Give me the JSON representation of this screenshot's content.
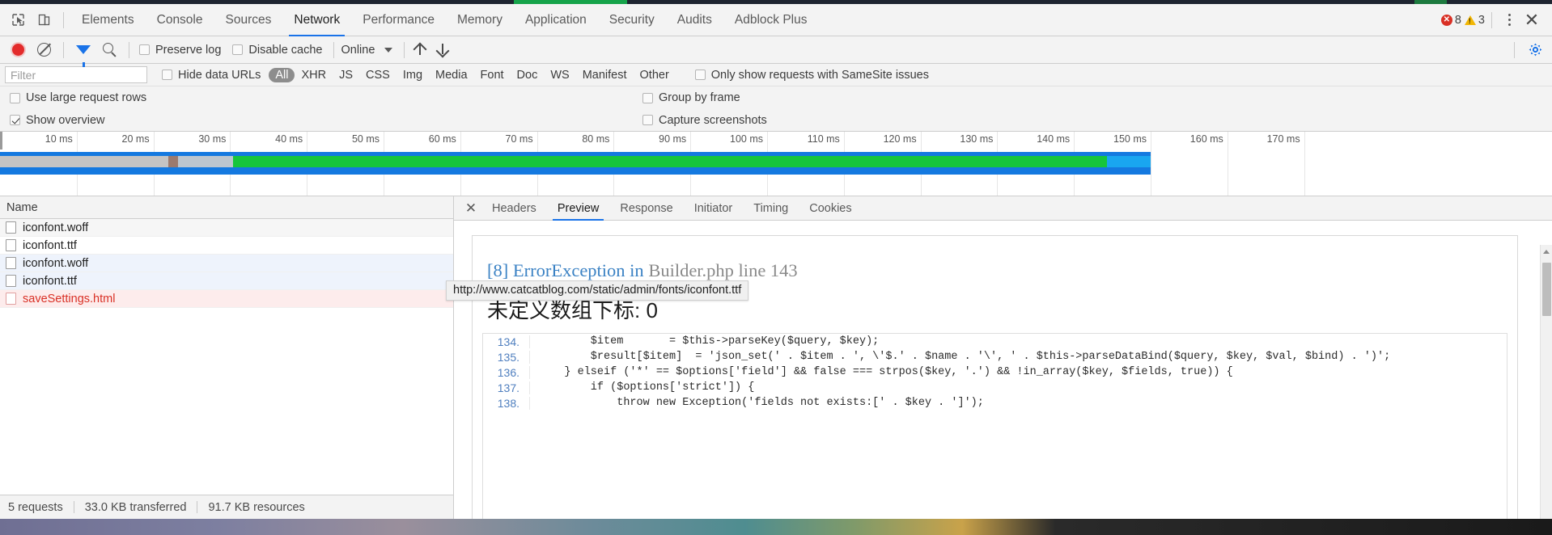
{
  "window": {
    "main_tabs": [
      {
        "label": "Elements",
        "active": false
      },
      {
        "label": "Console",
        "active": false
      },
      {
        "label": "Sources",
        "active": false
      },
      {
        "label": "Network",
        "active": true
      },
      {
        "label": "Performance",
        "active": false
      },
      {
        "label": "Memory",
        "active": false
      },
      {
        "label": "Application",
        "active": false
      },
      {
        "label": "Security",
        "active": false
      },
      {
        "label": "Audits",
        "active": false
      },
      {
        "label": "Adblock Plus",
        "active": false
      }
    ],
    "error_count": "8",
    "warning_count": "3"
  },
  "network_toolbar": {
    "preserve_log_label": "Preserve log",
    "preserve_log_checked": false,
    "disable_cache_label": "Disable cache",
    "disable_cache_checked": false,
    "throttling_value": "Online"
  },
  "filter_bar": {
    "filter_placeholder": "Filter",
    "filter_value": "",
    "hide_data_urls_label": "Hide data URLs",
    "hide_data_urls_checked": false,
    "type_chips": [
      {
        "label": "All",
        "active": true
      },
      {
        "label": "XHR",
        "active": false
      },
      {
        "label": "JS",
        "active": false
      },
      {
        "label": "CSS",
        "active": false
      },
      {
        "label": "Img",
        "active": false
      },
      {
        "label": "Media",
        "active": false
      },
      {
        "label": "Font",
        "active": false
      },
      {
        "label": "Doc",
        "active": false
      },
      {
        "label": "WS",
        "active": false
      },
      {
        "label": "Manifest",
        "active": false
      },
      {
        "label": "Other",
        "active": false
      }
    ],
    "samesite_label": "Only show requests with SameSite issues",
    "samesite_checked": false
  },
  "settings_rows": {
    "use_large_request_rows_label": "Use large request rows",
    "use_large_request_rows_checked": false,
    "group_by_frame_label": "Group by frame",
    "group_by_frame_checked": false,
    "show_overview_label": "Show overview",
    "show_overview_checked": true,
    "capture_screenshots_label": "Capture screenshots",
    "capture_screenshots_checked": false
  },
  "overview": {
    "ticks": [
      "10 ms",
      "20 ms",
      "30 ms",
      "40 ms",
      "50 ms",
      "60 ms",
      "70 ms",
      "80 ms",
      "90 ms",
      "100 ms",
      "110 ms",
      "120 ms",
      "130 ms",
      "140 ms",
      "150 ms",
      "160 ms",
      "170 ms"
    ],
    "colors": {
      "blue": "#1479e0",
      "green": "#16c53c",
      "light_blue": "#19a6f0",
      "gray": "#c4c4c4",
      "light_gray_blue": "#bcc6cf",
      "brown": "#9b7a6e"
    }
  },
  "requests_pane": {
    "column_header": "Name",
    "rows": [
      {
        "name": "iconfont.woff",
        "state": "odd"
      },
      {
        "name": "iconfont.ttf",
        "state": "even"
      },
      {
        "name": "iconfont.woff",
        "state": "hovered"
      },
      {
        "name": "iconfont.ttf",
        "state": "hovered"
      },
      {
        "name": "saveSettings.html",
        "state": "error"
      }
    ],
    "status": {
      "requests": "5 requests",
      "transferred": "33.0 KB transferred",
      "resources": "91.7 KB resources"
    }
  },
  "tooltip": {
    "text": "http://www.catcatblog.com/static/admin/fonts/iconfont.ttf"
  },
  "detail_pane": {
    "tabs": [
      {
        "label": "Headers",
        "active": false
      },
      {
        "label": "Preview",
        "active": true
      },
      {
        "label": "Response",
        "active": false
      },
      {
        "label": "Initiator",
        "active": false
      },
      {
        "label": "Timing",
        "active": false
      },
      {
        "label": "Cookies",
        "active": false
      }
    ],
    "preview": {
      "error_link": "[8] ErrorException in",
      "error_location": "Builder.php line 143",
      "error_message": "未定义数组下标: 0",
      "code_lines": [
        {
          "number": "134.",
          "code": "        $item       = $this->parseKey($query, $key);"
        },
        {
          "number": "135.",
          "code": "        $result[$item]  = 'json_set(' . $item . ', \\'$.' . $name . '\\', ' . $this->parseDataBind($query, $key, $val, $bind) . ')';"
        },
        {
          "number": "136.",
          "code": "    } elseif ('*' == $options['field'] && false === strpos($key, '.') && !in_array($key, $fields, true)) {"
        },
        {
          "number": "137.",
          "code": "        if ($options['strict']) {"
        },
        {
          "number": "138.",
          "code": "            throw new Exception('fields not exists:[' . $key . ']');"
        }
      ]
    }
  }
}
